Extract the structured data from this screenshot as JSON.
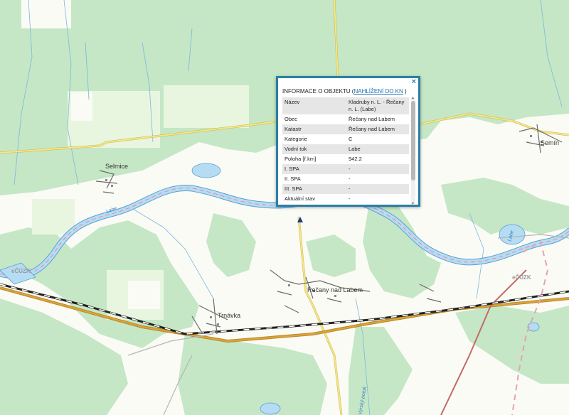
{
  "map": {
    "places": {
      "selmice": "Selmice",
      "semin": "Semín",
      "recany": "Řečany nad Labem",
      "trnavka": "Trnávka"
    },
    "river_label_1": "Labe",
    "river_label_2": "Labe",
    "stream_label": "Výrský potok",
    "watermark_1": "eČÚZK",
    "watermark_2": "eČÚZK"
  },
  "popup": {
    "close_glyph": "×",
    "title": "INFORMACE O OBJEKTU",
    "paren_open": " (",
    "link": "NAHLÍŽENÍ DO KN",
    "paren_close": " )",
    "rows": [
      {
        "key": "Název",
        "value": "Kladruby n. L. - Řečany n. L. (Labe)"
      },
      {
        "key": "Obec",
        "value": "Řečany nad Labem"
      },
      {
        "key": "Katastr",
        "value": "Řečany nad Labem"
      },
      {
        "key": "Kategorie",
        "value": "C"
      },
      {
        "key": "Vodní tok",
        "value": "Labe"
      },
      {
        "key": "Poloha [ř.km]",
        "value": "942.2"
      },
      {
        "key": "I. SPA",
        "value": "-"
      },
      {
        "key": "II. SPA",
        "value": "-"
      },
      {
        "key": "III. SPA",
        "value": "-"
      },
      {
        "key": "Aktuální stav",
        "value": "-"
      }
    ]
  },
  "colors": {
    "forest": "#c5e7c5",
    "forest_dark": "#a9d8a9",
    "river": "#b5dcf2",
    "river_edge": "#5a9fd4",
    "road": "#ecd75a",
    "rail": "#222222",
    "popup_border": "#2a7fa6"
  }
}
